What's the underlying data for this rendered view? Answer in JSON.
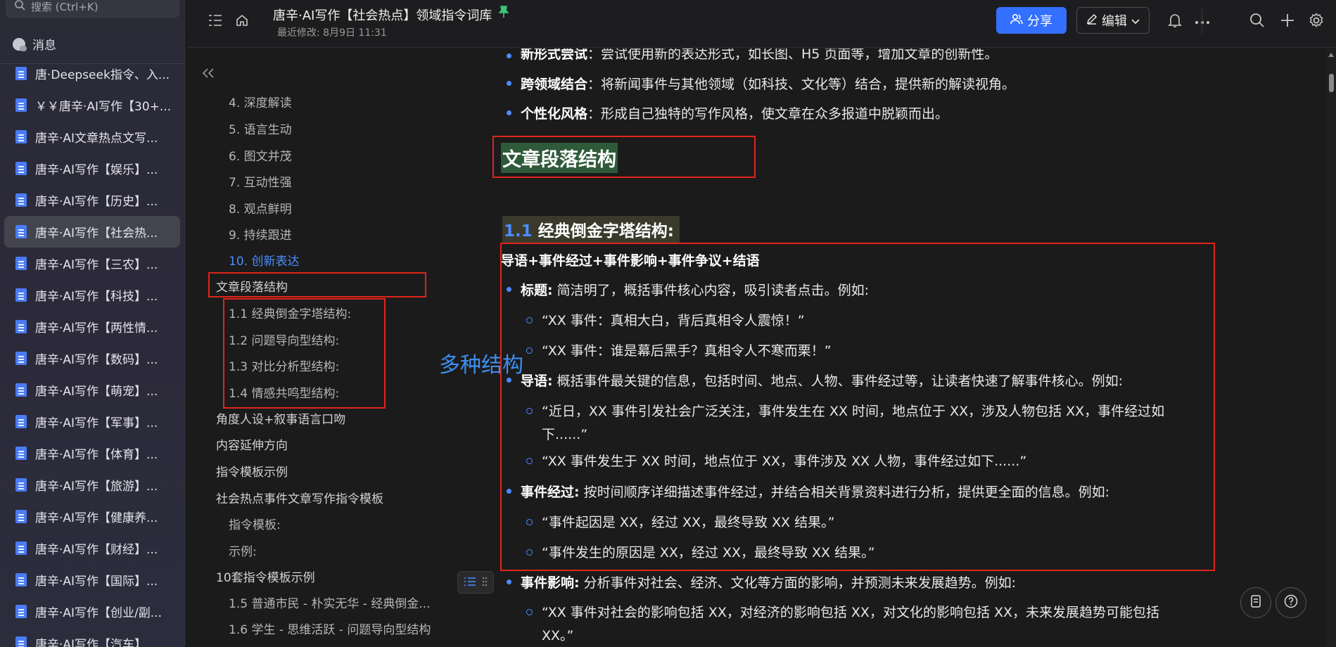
{
  "sidebar": {
    "search_placeholder": "搜索 (Ctrl+K)",
    "messages_label": "消息",
    "docs": [
      {
        "label": "唐·Deepseek指令、入..."
      },
      {
        "label": "￥￥唐辛·AI写作【30+..."
      },
      {
        "label": "唐辛·AI文章热点文写..."
      },
      {
        "label": "唐辛·AI写作【娱乐】..."
      },
      {
        "label": "唐辛·AI写作【历史】..."
      },
      {
        "label": "唐辛·AI写作【社会热..."
      },
      {
        "label": "唐辛·AI写作【三农】..."
      },
      {
        "label": "唐辛·AI写作【科技】..."
      },
      {
        "label": "唐辛·AI写作【两性情..."
      },
      {
        "label": "唐辛·AI写作【数码】..."
      },
      {
        "label": "唐辛·AI写作【萌宠】..."
      },
      {
        "label": "唐辛·AI写作【军事】..."
      },
      {
        "label": "唐辛·AI写作【体育】..."
      },
      {
        "label": "唐辛·AI写作【旅游】..."
      },
      {
        "label": "唐辛·AI写作【健康养..."
      },
      {
        "label": "唐辛·AI写作【财经】..."
      },
      {
        "label": "唐辛·AI写作【国际】..."
      },
      {
        "label": "唐辛·AI写作【创业/副..."
      },
      {
        "label": "唐辛·AI写作【汽车】..."
      }
    ],
    "active_index": 5
  },
  "topbar": {
    "title": "唐辛·AI写作【社会热点】领域指令词库",
    "modified": "最近修改: 8月9日 11:31",
    "share_label": "分享",
    "edit_label": "编辑"
  },
  "outline": {
    "items": [
      {
        "label": "4. 深度解读"
      },
      {
        "label": "5. 语言生动"
      },
      {
        "label": "6. 图文并茂"
      },
      {
        "label": "7. 互动性强"
      },
      {
        "label": "8. 观点鲜明"
      },
      {
        "label": "9. 持续跟进"
      },
      {
        "label": "10. 创新表达"
      },
      {
        "label": "文章段落结构"
      },
      {
        "label": "1.1 经典倒金字塔结构:"
      },
      {
        "label": "1.2 问题导向型结构:"
      },
      {
        "label": "1.3 对比分析型结构:"
      },
      {
        "label": "1.4 情感共鸣型结构:"
      },
      {
        "label": "角度人设+叙事语言口吻"
      },
      {
        "label": "内容延伸方向"
      },
      {
        "label": "指令模板示例"
      },
      {
        "label": "社会热点事件文章写作指令模板"
      },
      {
        "label": "指令模板:"
      },
      {
        "label": "示例:"
      },
      {
        "label": "10套指令模板示例"
      },
      {
        "label": "1.5 普通市民 - 朴实无华 - 经典倒金..."
      },
      {
        "label": "1.6 学生 - 思维活跃 - 问题导向型结构"
      }
    ]
  },
  "annotation": "多种结构",
  "content": {
    "top_bullets": [
      {
        "bold": "新形式尝试",
        "text": "：尝试使用新的表达形式，如长图、H5 页面等，增加文章的创新性。"
      },
      {
        "bold": "跨领域结合",
        "text": "：将新闻事件与其他领域（如科技、文化等）结合，提供新的解读视角。"
      },
      {
        "bold": "个性化风格",
        "text": "：形成自己独特的写作风格，使文章在众多报道中脱颖而出。"
      }
    ],
    "h1": "文章段落结构",
    "h2_num": "1.1",
    "h2_text": "经典倒金字塔结构:",
    "formula": "导语+事件经过+事件影响+事件争议+结语",
    "l1": {
      "bold": "标题:",
      "text": " 简洁明了，概括事件核心内容，吸引读者点击。例如:"
    },
    "l2": "“XX 事件：真相大白，背后真相令人震惊！”",
    "l3": "“XX 事件：谁是幕后黑手？真相令人不寒而栗！”",
    "l4": {
      "bold": "导语:",
      "text": " 概括事件最关键的信息，包括时间、地点、人物、事件经过等，让读者快速了解事件核心。例如:"
    },
    "l5a": "“近日，XX 事件引发社会广泛关注，事件发生在 XX 时间，地点位于 XX，涉及人物包括 XX，事件经过如",
    "l5b": "下......”",
    "l6": "“XX 事件发生于 XX 时间，地点位于 XX，事件涉及 XX 人物，事件经过如下......”",
    "l7": {
      "bold": "事件经过:",
      "text": " 按时间顺序详细描述事件经过，并结合相关背景资料进行分析，提供更全面的信息。例如:"
    },
    "l8": "“事件起因是 XX，经过 XX，最终导致 XX 结果。”",
    "l9": "“事件发生的原因是 XX，经过 XX，最终导致 XX 结果。”",
    "l10": {
      "bold": "事件影响:",
      "text": " 分析事件对社会、经济、文化等方面的影响，并预测未来发展趋势。例如:"
    },
    "l11a": "“XX 事件对社会的影响包括 XX，对经济的影响包括 XX，对文化的影响包括 XX，未来发展趋势可能包括",
    "l11b": "XX。”"
  },
  "colors": {
    "accent": "#3370ff",
    "highlight_box": "#e0241c",
    "annotation": "#3b8ff0"
  }
}
